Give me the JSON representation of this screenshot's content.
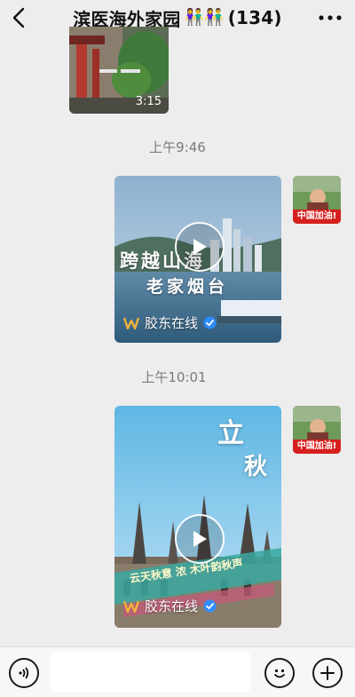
{
  "header": {
    "title": "滨医海外家园",
    "title_emoji": "👫👫",
    "member_count": "(134)"
  },
  "messages": [
    {
      "type": "video",
      "duration": "3:15"
    },
    {
      "type": "timestamp",
      "text": "上午9:46"
    },
    {
      "type": "video",
      "overlay_text_1": "跨越山海",
      "overlay_text_2": "老家烟台",
      "channel": "胶东在线"
    },
    {
      "type": "timestamp",
      "text": "上午10:01"
    },
    {
      "type": "video",
      "overlay_text_1": "立",
      "overlay_text_2": "秋",
      "banner_text": "云天秋意 浓  木叶韵秋声",
      "channel": "胶东在线"
    }
  ],
  "avatar_caption": "中国加油!",
  "input": {
    "value": "",
    "placeholder": ""
  },
  "colors": {
    "background": "#ededed",
    "badge": "#2f8cff",
    "avatar_banner": "#d6201e"
  }
}
